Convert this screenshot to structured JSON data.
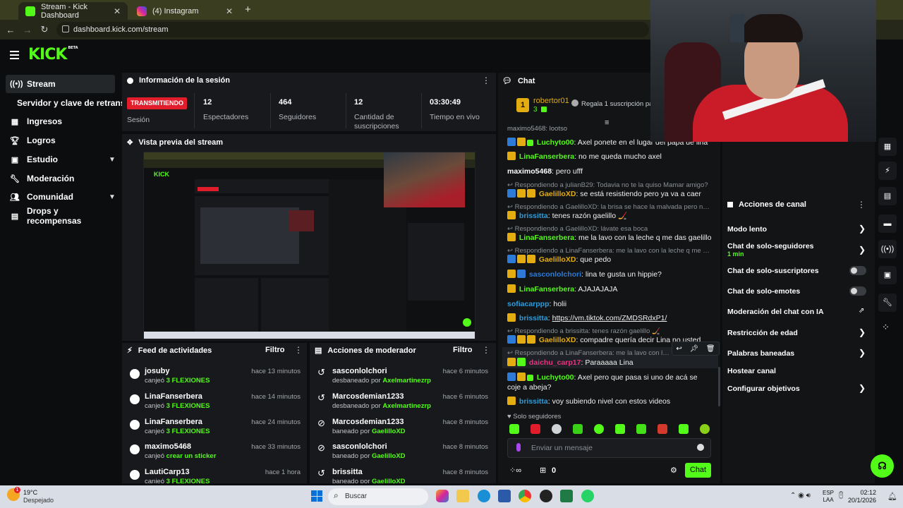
{
  "browser": {
    "tabs": [
      {
        "label": "Stream - Kick Dashboard",
        "active": true
      },
      {
        "label": "(4) Instagram",
        "active": false
      }
    ],
    "new_tab": "+",
    "url": "dashboard.kick.com/stream"
  },
  "kick": {
    "logo": "KICK",
    "logo_beta": "BETA"
  },
  "sidebar": {
    "items": [
      {
        "label": "Stream",
        "icon": "stream-icon"
      },
      {
        "label": "Servidor y clave de retransmisión"
      },
      {
        "label": "Ingresos",
        "icon": "income-icon"
      },
      {
        "label": "Logros",
        "icon": "trophy-icon"
      },
      {
        "label": "Estudio",
        "icon": "studio-icon"
      },
      {
        "label": "Moderación",
        "icon": "wrench-icon"
      },
      {
        "label": "Comunidad",
        "icon": "community-icon"
      },
      {
        "label": "Drops y recompensas",
        "icon": "drops-icon"
      }
    ]
  },
  "session": {
    "title": "Información de la sesión",
    "badge": "TRANSMITIENDO",
    "badge_label": "Sesión",
    "stats": [
      {
        "value": "12",
        "label": "Espectadores"
      },
      {
        "value": "464",
        "label": "Seguidores"
      },
      {
        "value": "12",
        "label": "Cantidad de suscripciones"
      },
      {
        "value": "03:30:49",
        "label": "Tiempo en vivo"
      }
    ]
  },
  "preview": {
    "title": "Vista previa del stream"
  },
  "activity_feed": {
    "title": "Feed de actividades",
    "filter": "Filtro",
    "items": [
      {
        "user": "josuby",
        "action": "canjeó",
        "reward": "3 FLEXIONES",
        "time": "hace 13 minutos"
      },
      {
        "user": "LinaFanserbera",
        "action": "canjeó",
        "reward": "3 FLEXIONES",
        "time": "hace 14 minutos"
      },
      {
        "user": "LinaFanserbera",
        "action": "canjeó",
        "reward": "3 FLEXIONES",
        "time": "hace 24 minutos"
      },
      {
        "user": "maximo5468",
        "action": "canjeó",
        "reward": "crear un sticker",
        "time": "hace 33 minutos"
      },
      {
        "user": "LautiCarp13",
        "action": "canjeó",
        "reward": "3 FLEXIONES",
        "time": "hace 1 hora"
      }
    ]
  },
  "mod_actions": {
    "title": "Acciones de moderador",
    "filter": "Filtro",
    "items": [
      {
        "user": "sasconlolchori",
        "action": "desbaneado por",
        "mod": "Axelmartinezrp",
        "time": "hace 6 minutos"
      },
      {
        "user": "Marcosdemian1233",
        "action": "desbaneado por",
        "mod": "Axelmartinezrp",
        "time": "hace 6 minutos"
      },
      {
        "user": "Marcosdemian1233",
        "action": "baneado por",
        "mod": "GaelilloXD",
        "time": "hace 8 minutos"
      },
      {
        "user": "sasconlolchori",
        "action": "baneado por",
        "mod": "GaelilloXD",
        "time": "hace 8 minutos"
      },
      {
        "user": "brissitta",
        "action": "baneado por",
        "mod": "GaelilloXD",
        "time": "hace 8 minutos"
      }
    ]
  },
  "chat": {
    "title": "Chat",
    "pinned_user": "robertor01",
    "pinned_rank": "1",
    "pinned_count": "3",
    "gift_text": "Regala 1 suscripción para",
    "partial_top": "maximo5468: lootso",
    "messages": [
      {
        "reply": "",
        "user": "Luchyto00",
        "color": "#53fc18",
        "text": "Axel ponete en el lugar del papá de lina"
      },
      {
        "reply": "",
        "user": "LinaFanserbera",
        "color": "#53fc18",
        "text": "no me queda mucho axel"
      },
      {
        "reply": "",
        "user": "maximo5468",
        "color": "#ffffff",
        "text": "pero ufff"
      },
      {
        "reply": "Respondiendo a julianB29: Todavia no te la quiso Mamar amigo?",
        "user": "GaelilloXD",
        "color": "#e3ad12",
        "text": "se está resistiendo pero ya va a caer"
      },
      {
        "reply": "Respondiendo a GaelilloXD: la brisa se hace la malvada pero no me qu...",
        "user": "brissitta",
        "color": "#2d9cdb",
        "text": "tenes razón gaelillo 🏒"
      },
      {
        "reply": "Respondiendo a GaelilloXD: lávate esa boca",
        "user": "LinaFanserbera",
        "color": "#53fc18",
        "text": "me la lavo con la leche q me das gaelillo"
      },
      {
        "reply": "Respondiendo a LinaFanserbera: me la lavo con la leche q me das gae...",
        "user": "GaelilloXD",
        "color": "#e3ad12",
        "text": "que pedo"
      },
      {
        "reply": "",
        "user": "sasconlolchori",
        "color": "#2d7bd6",
        "text": "lina te gusta un hippie?"
      },
      {
        "reply": "",
        "user": "LinaFanserbera",
        "color": "#53fc18",
        "text": "AJAJAJAJA"
      },
      {
        "reply": "",
        "user": "sofiacarppp",
        "color": "#2d9cdb",
        "text": "holii"
      },
      {
        "reply": "",
        "user": "brissitta",
        "color": "#2d9cdb",
        "text": "https://vm.tiktok.com/ZMDSRdxP1/"
      },
      {
        "reply": "Respondiendo a brissitta: tenes razón gaelillo 🏒",
        "user": "GaelilloXD",
        "color": "#e3ad12",
        "text": "compadre quería decir Lina no usted"
      },
      {
        "reply": "Respondiendo a LinaFanserbera: me la lavo con la leche q m...",
        "user": "daichu_carp17",
        "color": "#e3357f",
        "text": "Paraaaaa Lina"
      },
      {
        "reply": "",
        "user": "Luchyto00",
        "color": "#53fc18",
        "text": "Axel pero que pasa si uno de acá se coje a abeja?"
      },
      {
        "reply": "",
        "user": "brissitta",
        "color": "#2d9cdb",
        "text": "voy subiendo nivel con estos videos"
      }
    ],
    "followers_only": "Solo seguidores",
    "input_placeholder": "Enviar un mensaje",
    "points": "0",
    "send": "Chat"
  },
  "channel_actions": {
    "title": "Acciones de canal",
    "items": [
      {
        "label": "Modo lento",
        "type": "chevron"
      },
      {
        "label": "Chat de solo-seguidores",
        "sub": "1 min",
        "type": "chevron"
      },
      {
        "label": "Chat de solo-suscriptores",
        "type": "toggle"
      },
      {
        "label": "Chat de solo-emotes",
        "type": "toggle"
      },
      {
        "label": "Moderación del chat con IA",
        "type": "external"
      },
      {
        "label": "Restricción de edad",
        "type": "chevron"
      },
      {
        "label": "Palabras baneadas",
        "type": "chevron"
      },
      {
        "label": "Hostear canal",
        "type": "none"
      },
      {
        "label": "Configurar objetivos",
        "type": "chevron"
      }
    ]
  },
  "taskbar": {
    "weather_temp": "19°C",
    "weather_desc": "Despejado",
    "search": "Buscar",
    "lang": "ESP",
    "lang2": "LAA",
    "time": "02:12",
    "date": "20/1/2026",
    "notif_badge": "1"
  },
  "colors": {
    "kick_green": "#53fc18",
    "live_red": "#e21d2b",
    "panel_bg": "#17191c"
  }
}
